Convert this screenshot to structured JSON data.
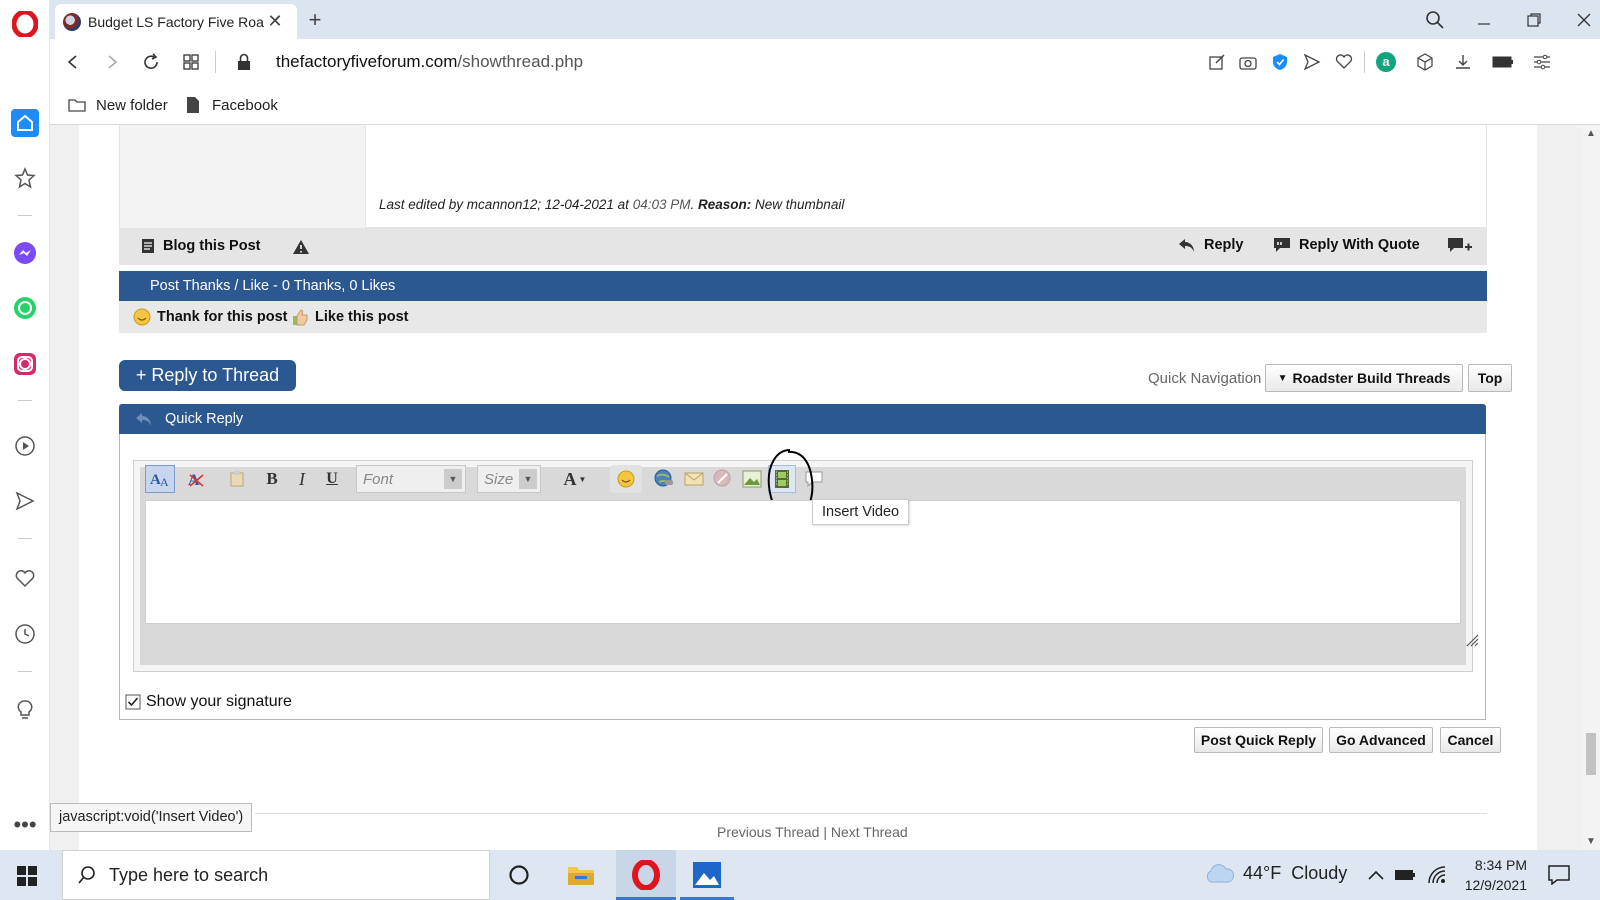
{
  "browser": {
    "tab_title": "Budget LS Factory Five Roa",
    "url_domain": "thefactoryfiveforum.com",
    "url_path": "/showthread.php",
    "bookmarks": [
      {
        "label": "New folder"
      },
      {
        "label": "Facebook"
      }
    ],
    "status_url": "javascript:void('Insert Video')"
  },
  "post": {
    "edit_note_prefix": "Last edited by mcannon12; 12-04-2021 at ",
    "edit_time": "04:03 PM",
    "edit_reason_label": "Reason:",
    "edit_reason": "New thumbnail",
    "blog_label": "Blog this Post",
    "reply_label": "Reply",
    "reply_quote_label": "Reply With Quote",
    "thanks_bar": "Post Thanks / Like - 0 Thanks, 0 Likes",
    "thank_label": "Thank for this post",
    "like_label": "Like this post"
  },
  "thread": {
    "reply_to_thread": "+ Reply to Thread",
    "quick_nav_label": "Quick Navigation",
    "quick_nav_selected": "Roadster Build Threads",
    "top_label": "Top"
  },
  "quick_reply": {
    "title": "Quick Reply",
    "font_placeholder": "Font",
    "size_placeholder": "Size",
    "tooltip": "Insert Video",
    "show_signature": "Show your signature",
    "post_button": "Post Quick Reply",
    "advanced_button": "Go Advanced",
    "cancel_button": "Cancel",
    "footer_partial": "Previous Thread | Next Thread"
  },
  "taskbar": {
    "search_placeholder": "Type here to search",
    "weather": "44°F  Cloudy",
    "time": "8:34 PM",
    "date": "12/9/2021"
  },
  "colors": {
    "forum_blue": "#2b5890",
    "bar_gray": "#e8e8e8",
    "opera_red": "#e0141e"
  }
}
